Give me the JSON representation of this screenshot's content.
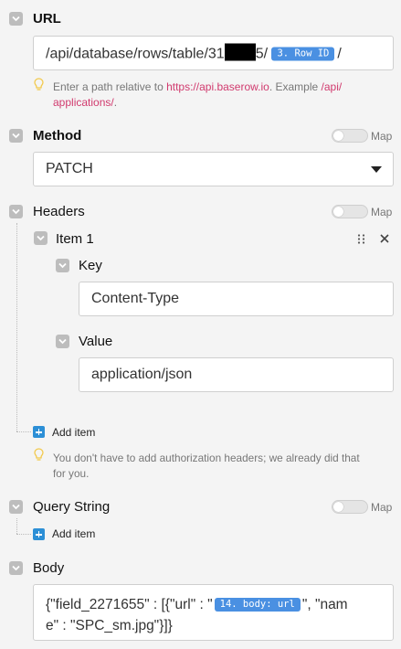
{
  "url": {
    "label": "URL",
    "prefix": "/api/database/rows/table/31",
    "suffix": "5/",
    "tag": "3. Row ID",
    "trailing": "/",
    "hint_text": "Enter a path relative to ",
    "hint_link": "https://api.baserow.io",
    "hint_example": ". Example ",
    "hint_example_path_1": "/api/",
    "hint_example_path_2": "applications/",
    "hint_end": "."
  },
  "method": {
    "label": "Method",
    "map_label": "Map",
    "value": "PATCH"
  },
  "headers": {
    "label": "Headers",
    "map_label": "Map",
    "item": {
      "label": "Item 1",
      "key_label": "Key",
      "key_value": "Content-Type",
      "value_label": "Value",
      "value_value": "application/json"
    },
    "add_item": "Add item",
    "hint_line_1": "You don't have to add authorization headers; we already did that",
    "hint_line_2": "for you."
  },
  "query_string": {
    "label": "Query String",
    "map_label": "Map",
    "add_item": "Add item"
  },
  "body": {
    "label": "Body",
    "line1_a": "{\"field_2271655\" : [{\"url\" : \"",
    "line1_tag": "14. body: url",
    "line1_b": "\", \"nam",
    "line2": "e\" : \"SPC_sm.jpg\"}]}"
  },
  "icons": {
    "collapse": "chevron-down-icon",
    "bulb": "lightbulb-icon",
    "drag": "drag-handle-icon",
    "close": "close-icon",
    "add": "plus-icon",
    "dropdown": "caret-down-icon"
  },
  "colors": {
    "accent": "#4a90e2",
    "link": "#d13a6e",
    "add_button": "#2c8fd6",
    "bulb": "#f2c94c"
  }
}
